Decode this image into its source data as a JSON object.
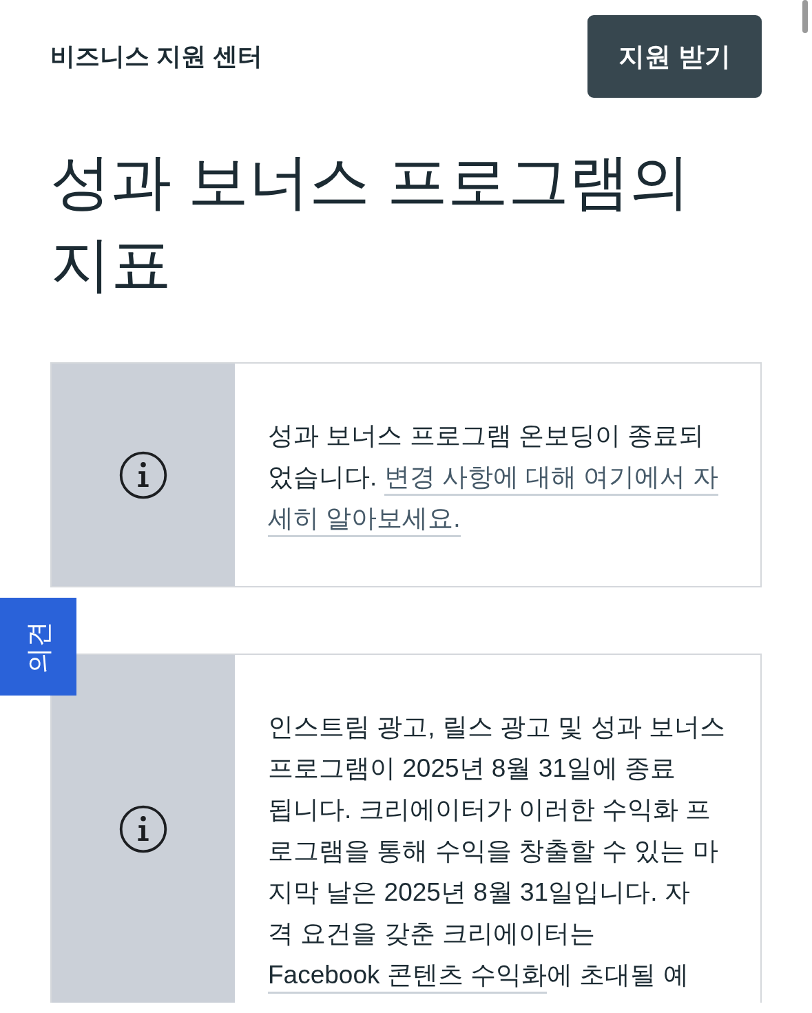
{
  "header": {
    "site_title": "비즈니스 지원 센터",
    "button": "지원 받기"
  },
  "page_title": "성과 보너스 프로그램의 지표",
  "notices": [
    {
      "lines": [
        [
          {
            "kind": "text",
            "text": "성과 보너스 프로그램 온보딩이 종료되"
          }
        ],
        [
          {
            "kind": "text",
            "text": "었습니다. "
          },
          {
            "kind": "link",
            "text": "변경 사항에 대해 여기에서 자"
          }
        ],
        [
          {
            "kind": "link",
            "text": "세히 알아보세요."
          }
        ]
      ]
    },
    {
      "lines": [
        [
          {
            "kind": "text",
            "text": "인스트림 광고, 릴스 광고 및 성과 보너스"
          }
        ],
        [
          {
            "kind": "text",
            "text": "프로그램이 2025년 8월 31일에 종료"
          }
        ],
        [
          {
            "kind": "text",
            "text": "됩니다. 크리에이터가 이러한 수익화 프"
          }
        ],
        [
          {
            "kind": "text",
            "text": "로그램을 통해 수익을 창출할 수 있는 마"
          }
        ],
        [
          {
            "kind": "text",
            "text": "지막 날은 2025년 8월 31일입니다. 자"
          }
        ],
        [
          {
            "kind": "text",
            "text": "격 요건을 갖춘 크리에이터는"
          }
        ],
        [
          {
            "kind": "link",
            "text": "Facebook 콘텐츠 수익화"
          },
          {
            "kind": "text",
            "text": "에 초대될 예"
          }
        ]
      ]
    }
  ],
  "feedback_tab": "의견"
}
